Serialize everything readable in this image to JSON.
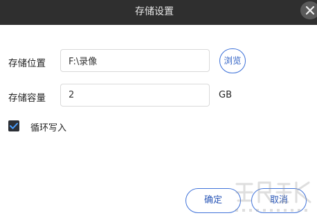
{
  "dialog": {
    "title": "存储设置",
    "close_icon": "close-icon"
  },
  "storage_location": {
    "label": "存储位置",
    "value": "F:\\录像",
    "browse_label": "浏览"
  },
  "storage_capacity": {
    "label": "存储容量",
    "value": "2",
    "unit": "GB"
  },
  "loop_write": {
    "label": "循环写入",
    "checked": true
  },
  "footer": {
    "ok_label": "确定",
    "cancel_label": "取消"
  },
  "colors": {
    "titlebar": "#2f2f2f",
    "accent": "#3a6fd8",
    "checkbox": "#2c2f36"
  }
}
